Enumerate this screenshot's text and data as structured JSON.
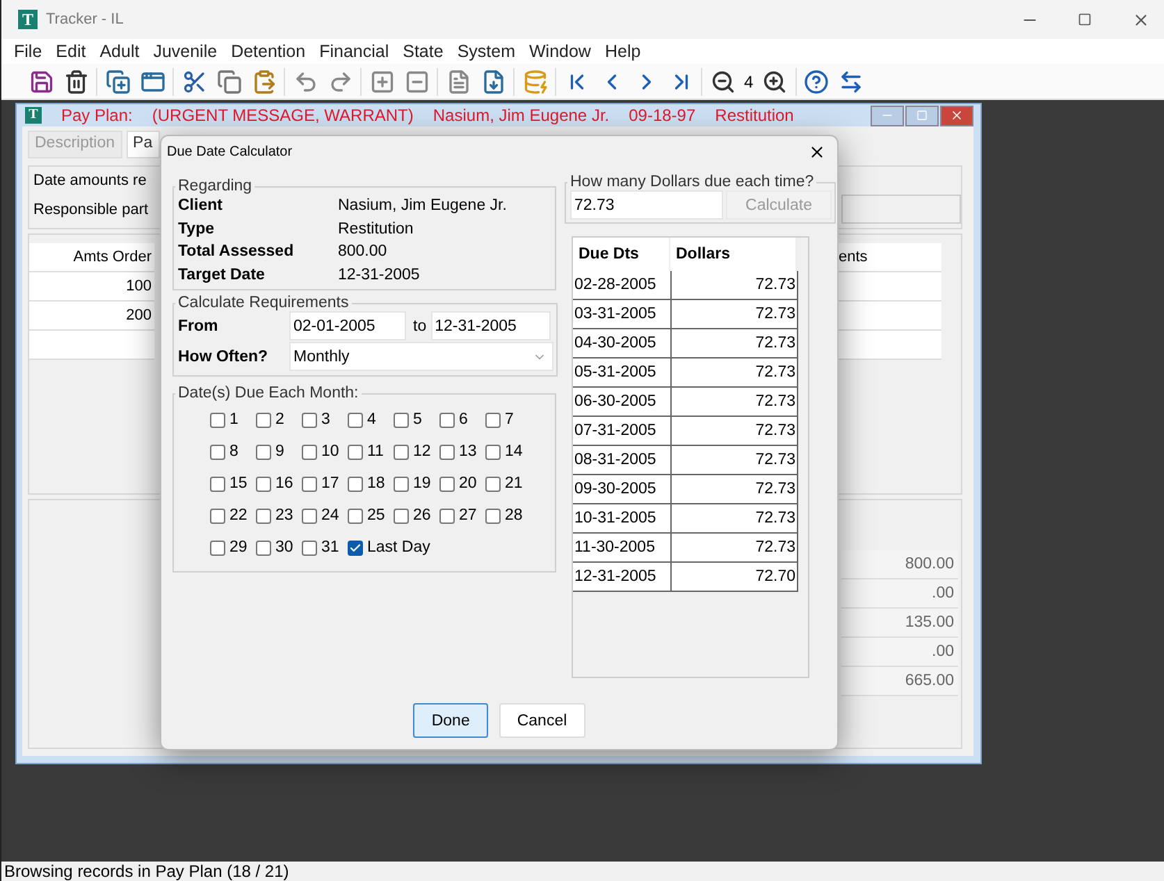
{
  "window": {
    "icon_letter": "T",
    "title": "Tracker - IL"
  },
  "menu": [
    "File",
    "Edit",
    "Adult",
    "Juvenile",
    "Detention",
    "Financial",
    "State",
    "System",
    "Window",
    "Help"
  ],
  "toolbar": {
    "zoom_level": "4"
  },
  "child_window": {
    "icon_letter": "T",
    "title_parts": [
      "Pay Plan:",
      "(URGENT MESSAGE, WARRANT)",
      "Nasium, Jim Eugene Jr.",
      "09-18-97",
      "Restitution"
    ],
    "tabs": [
      {
        "label": "Description",
        "selected": false
      },
      {
        "label": "Pa",
        "selected": true
      }
    ],
    "labels": [
      "Date amounts re",
      "Responsible part"
    ],
    "table": {
      "column_1": "Amts Order",
      "column_2": "ents",
      "rows": [
        "100",
        "200"
      ]
    },
    "totals": [
      "800.00",
      ".00",
      "135.00",
      ".00",
      "665.00"
    ]
  },
  "dialog": {
    "title": "Due Date Calculator",
    "regarding": {
      "legend": "Regarding",
      "rows": [
        {
          "label": "Client",
          "value": "Nasium, Jim Eugene Jr."
        },
        {
          "label": "Type",
          "value": "Restitution"
        },
        {
          "label": "Total Assessed",
          "value": "800.00"
        },
        {
          "label": "Target Date",
          "value": "12-31-2005"
        }
      ]
    },
    "requirements": {
      "legend": "Calculate Requirements",
      "from_label": "From",
      "from": "02-01-2005",
      "to_label": "to",
      "to": "12-31-2005",
      "how_often_label": "How Often?",
      "how_often": "Monthly"
    },
    "dates": {
      "legend": "Date(s) Due Each Month:",
      "options": [
        {
          "label": "1",
          "checked": false
        },
        {
          "label": "2",
          "checked": false
        },
        {
          "label": "3",
          "checked": false
        },
        {
          "label": "4",
          "checked": false
        },
        {
          "label": "5",
          "checked": false
        },
        {
          "label": "6",
          "checked": false
        },
        {
          "label": "7",
          "checked": false
        },
        {
          "label": "8",
          "checked": false
        },
        {
          "label": "9",
          "checked": false
        },
        {
          "label": "10",
          "checked": false
        },
        {
          "label": "11",
          "checked": false
        },
        {
          "label": "12",
          "checked": false
        },
        {
          "label": "13",
          "checked": false
        },
        {
          "label": "14",
          "checked": false
        },
        {
          "label": "15",
          "checked": false
        },
        {
          "label": "16",
          "checked": false
        },
        {
          "label": "17",
          "checked": false
        },
        {
          "label": "18",
          "checked": false
        },
        {
          "label": "19",
          "checked": false
        },
        {
          "label": "20",
          "checked": false
        },
        {
          "label": "21",
          "checked": false
        },
        {
          "label": "22",
          "checked": false
        },
        {
          "label": "23",
          "checked": false
        },
        {
          "label": "24",
          "checked": false
        },
        {
          "label": "25",
          "checked": false
        },
        {
          "label": "26",
          "checked": false
        },
        {
          "label": "27",
          "checked": false
        },
        {
          "label": "28",
          "checked": false
        },
        {
          "label": "29",
          "checked": false
        },
        {
          "label": "30",
          "checked": false
        },
        {
          "label": "31",
          "checked": false
        },
        {
          "label": "Last Day",
          "checked": true
        }
      ]
    },
    "dollars": {
      "legend": "How many Dollars due each time?",
      "value": "72.73",
      "calculate": {
        "label": "Calculate",
        "disabled": true
      }
    },
    "schedule": {
      "columns": [
        "Due Dts",
        "Dollars"
      ],
      "rows": [
        [
          "02-28-2005",
          "72.73"
        ],
        [
          "03-31-2005",
          "72.73"
        ],
        [
          "04-30-2005",
          "72.73"
        ],
        [
          "05-31-2005",
          "72.73"
        ],
        [
          "06-30-2005",
          "72.73"
        ],
        [
          "07-31-2005",
          "72.73"
        ],
        [
          "08-31-2005",
          "72.73"
        ],
        [
          "09-30-2005",
          "72.73"
        ],
        [
          "10-31-2005",
          "72.73"
        ],
        [
          "11-30-2005",
          "72.73"
        ],
        [
          "12-31-2005",
          "72.70"
        ]
      ]
    },
    "buttons": [
      {
        "label": "Done",
        "default": true
      },
      {
        "label": "Cancel",
        "default": false
      }
    ]
  },
  "status_bar": "Browsing records in Pay Plan (18 / 21)"
}
